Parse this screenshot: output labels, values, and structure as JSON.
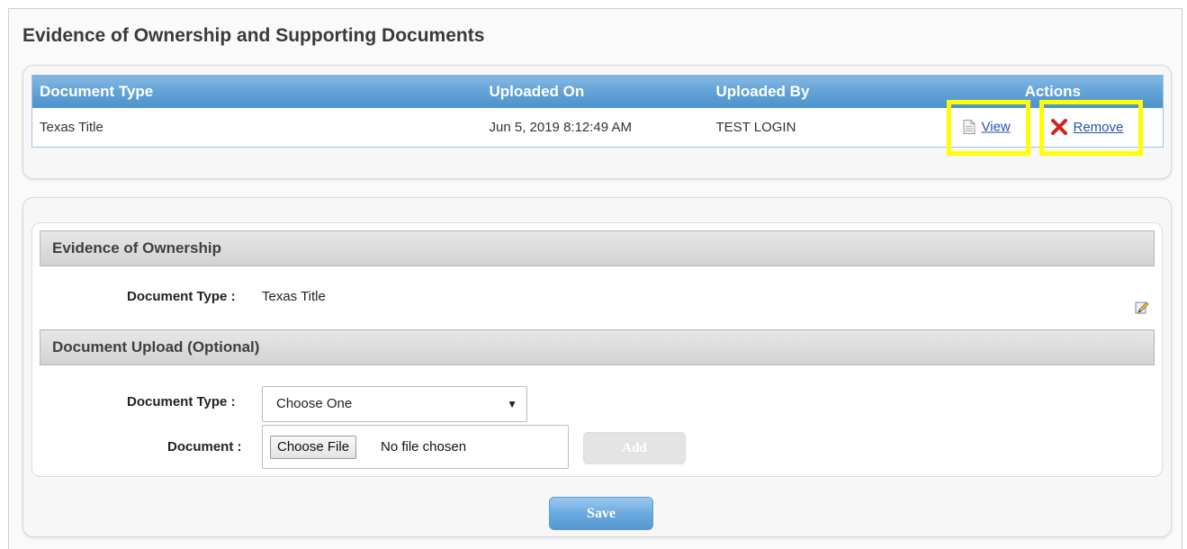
{
  "page_title": "Evidence of Ownership and Supporting Documents",
  "documents_table": {
    "columns": [
      "Document Type",
      "Uploaded On",
      "Uploaded By",
      "Actions"
    ],
    "rows": [
      {
        "document_type": "Texas Title",
        "uploaded_on": "Jun 5, 2019 8:12:49 AM",
        "uploaded_by": "TEST LOGIN",
        "view_label": "View",
        "remove_label": "Remove"
      }
    ],
    "highlight_color": "#ffff00"
  },
  "ownership_section": {
    "header": "Evidence of Ownership",
    "document_type_label": "Document Type :",
    "document_type_value": "Texas Title",
    "edit_icon": "edit-pencil-icon"
  },
  "upload_section": {
    "header": "Document Upload (Optional)",
    "document_type_label": "Document Type :",
    "document_type_selected": "Choose One",
    "document_label": "Document :",
    "choose_file_label": "Choose File",
    "file_status": "No file chosen",
    "add_label": "Add"
  },
  "save_label": "Save",
  "colors": {
    "header_blue": "#5fa0d5",
    "link_blue": "#2255aa",
    "remove_red": "#d42020"
  }
}
